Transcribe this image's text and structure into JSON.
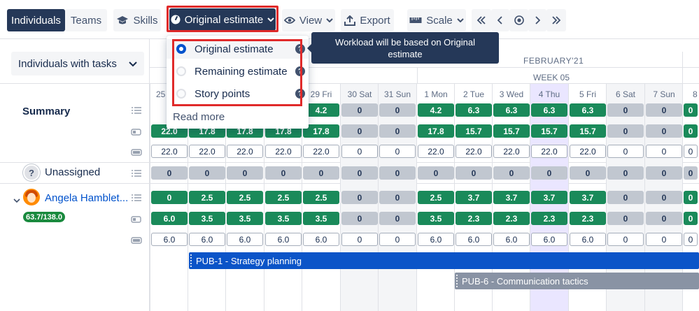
{
  "toolbar": {
    "individuals": "Individuals",
    "teams": "Teams",
    "skills": "Skills",
    "original_estimate": "Original estimate",
    "view": "View",
    "export": "Export",
    "scale": "Scale"
  },
  "left": {
    "group_select": "Individuals with tasks",
    "summary": "Summary",
    "unassigned": "Unassigned",
    "unassigned_icon_text": "?",
    "user_name": "Angela Hamblet...",
    "user_badge": "63.7/138.0"
  },
  "dropdown": {
    "options": [
      {
        "label": "Original estimate",
        "selected": true
      },
      {
        "label": "Remaining estimate",
        "selected": false
      },
      {
        "label": "Story points",
        "selected": false
      }
    ],
    "help_glyph": "?",
    "read_more": "Read more"
  },
  "tooltip": "Workload will be based on Original estimate",
  "calendar": {
    "month": "FEBRUARY'21",
    "week": "WEEK 05",
    "days": [
      "25",
      "",
      "",
      "",
      "29 Fri",
      "30 Sat",
      "31 Sun",
      "1 Mon",
      "2 Tue",
      "3 Wed",
      "4 Thu",
      "5 Fri",
      "6 Sat",
      "7 Sun",
      "8 M"
    ]
  },
  "rows": {
    "summary_tasks": [
      "",
      "",
      "",
      "",
      "4.2",
      "0",
      "0",
      "4.2",
      "6.3",
      "6.3",
      "6.3",
      "6.3",
      "0",
      "0",
      "0"
    ],
    "summary_remaining": [
      "22.0",
      "17.8",
      "17.8",
      "17.8",
      "17.8",
      "0",
      "0",
      "17.8",
      "15.7",
      "15.7",
      "15.7",
      "15.7",
      "0",
      "0",
      "0"
    ],
    "summary_capacity": [
      "22.0",
      "22.0",
      "22.0",
      "22.0",
      "22.0",
      "0",
      "0",
      "22.0",
      "22.0",
      "22.0",
      "22.0",
      "22.0",
      "0",
      "0",
      "0"
    ],
    "unassigned": [
      "0",
      "0",
      "0",
      "0",
      "0",
      "0",
      "0",
      "0",
      "0",
      "0",
      "0",
      "0",
      "0",
      "0",
      "0"
    ],
    "user_tasks": [
      "0",
      "2.5",
      "2.5",
      "2.5",
      "2.5",
      "0",
      "0",
      "2.5",
      "3.7",
      "3.7",
      "3.7",
      "3.7",
      "0",
      "0",
      "0"
    ],
    "user_remaining": [
      "6.0",
      "3.5",
      "3.5",
      "3.5",
      "3.5",
      "0",
      "0",
      "3.5",
      "2.3",
      "2.3",
      "2.3",
      "2.3",
      "0",
      "0",
      "0"
    ],
    "user_capacity": [
      "6.0",
      "6.0",
      "6.0",
      "6.0",
      "6.0",
      "0",
      "0",
      "6.0",
      "6.0",
      "6.0",
      "6.0",
      "6.0",
      "0",
      "0",
      "0"
    ]
  },
  "tasks": [
    {
      "label": "PUB-1 - Strategy planning",
      "color": "#0b54c8"
    },
    {
      "label": "PUB-6 - Communication tactics",
      "color": "#8993a4"
    }
  ],
  "colors": {
    "accent_red": "#e02a2a",
    "green": "#1a8a5a",
    "navy": "#253858"
  }
}
